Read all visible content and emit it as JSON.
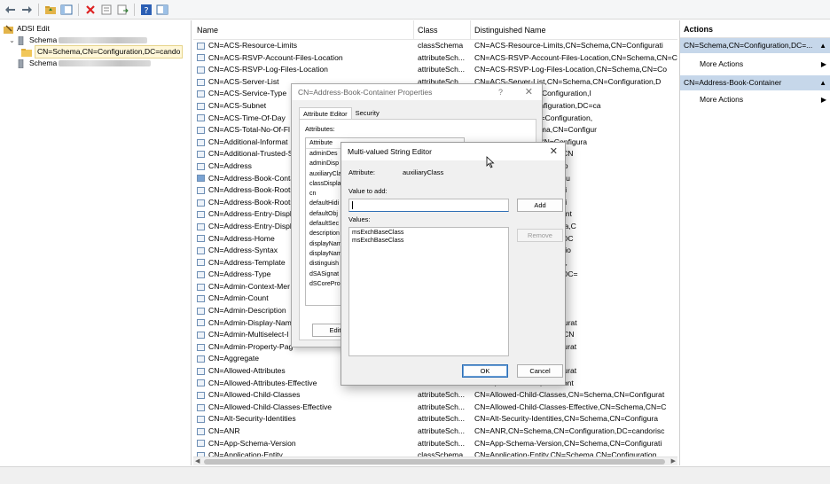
{
  "tree": {
    "root_label": "ADSI Edit",
    "schema_label": "Schema",
    "selected_label": "CN=Schema,CN=Configuration,DC=cando",
    "schema2_label": "Schema"
  },
  "list": {
    "headers": {
      "name": "Name",
      "class": "Class",
      "dn": "Distinguished Name"
    },
    "rows": [
      {
        "name": "CN=ACS-Resource-Limits",
        "class": "classSchema",
        "dn": "CN=ACS-Resource-Limits,CN=Schema,CN=Configurati"
      },
      {
        "name": "CN=ACS-RSVP-Account-Files-Location",
        "class": "attributeSch...",
        "dn": "CN=ACS-RSVP-Account-Files-Location,CN=Schema,CN=C"
      },
      {
        "name": "CN=ACS-RSVP-Log-Files-Location",
        "class": "attributeSch...",
        "dn": "CN=ACS-RSVP-Log-Files-Location,CN=Schema,CN=Co"
      },
      {
        "name": "CN=ACS-Server-List",
        "class": "attributeSch...",
        "dn": "CN=ACS-Server-List,CN=Schema,CN=Configuration,D"
      },
      {
        "name": "CN=ACS-Service-Type",
        "class": "",
        "dn": "e,CN=Schema,CN=Configuration,I"
      },
      {
        "name": "CN=ACS-Subnet",
        "class": "",
        "dn": "N=Schema,CN=Configuration,DC=ca"
      },
      {
        "name": "CN=ACS-Time-Of-Day",
        "class": "",
        "dn": "ay,CN=Schema,CN=Configuration,"
      },
      {
        "name": "CN=ACS-Total-No-Of-Fl",
        "class": "",
        "dn": "Of-Flows,CN=Schema,CN=Configur"
      },
      {
        "name": "CN=Additional-Informat",
        "class": "",
        "dn": "ation,CN=Schema,CN=Configura"
      },
      {
        "name": "CN=Additional-Trusted-S",
        "class": "",
        "dn": "vice-Names,CN=Schema,CN"
      },
      {
        "name": "CN=Address",
        "class": "",
        "dn": "N=Configuration,DC=cando"
      },
      {
        "name": "CN=Address-Book-Conta",
        "class": "",
        "dn": "er,CN=Schema,CN=Configu",
        "selected": true
      },
      {
        "name": "CN=Address-Book-Roots",
        "class": "",
        "dn": "N=Schema,CN=Configurati"
      },
      {
        "name": "CN=Address-Book-Roots",
        "class": "",
        "dn": "N=Schema,CN=Configurati"
      },
      {
        "name": "CN=Address-Entry-Displ",
        "class": "",
        "dn": "Table,CN=Schema,CN=Cont"
      },
      {
        "name": "CN=Address-Entry-Displ",
        "class": "",
        "dn": "Table-MSDOS,CN=Schema,C"
      },
      {
        "name": "CN=Address-Home",
        "class": "",
        "dn": "chema,CN=Configuration,DC"
      },
      {
        "name": "CN=Address-Syntax",
        "class": "",
        "dn": "N=Schema,CN=Configuratio"
      },
      {
        "name": "CN=Address-Template",
        "class": "",
        "dn": "Schema,CN=Configuration,"
      },
      {
        "name": "CN=Address-Type",
        "class": "",
        "dn": "chema,CN=Configuration,DC="
      },
      {
        "name": "CN=Admin-Context-Mer",
        "class": "",
        "dn": "N=Schema,CN=Configurat"
      },
      {
        "name": "CN=Admin-Count",
        "class": "",
        "dn": "N=Configuration,DC=cand"
      },
      {
        "name": "CN=Admin-Description",
        "class": "",
        "dn": "Schema,CN=Configuration"
      },
      {
        "name": "CN=Admin-Display-Nam",
        "class": "",
        "dn": "e,CN=Schema,CN=Configurat"
      },
      {
        "name": "CN=Admin-Multiselect-I",
        "class": "",
        "dn": "perty-Pages,CN=Schema,CN"
      },
      {
        "name": "CN=Admin-Property-Pag",
        "class": "",
        "dn": "s,CN=Schema,CN=Configurat"
      },
      {
        "name": "CN=Aggregate",
        "class": "",
        "dn": "N=Configuration,DC=can"
      },
      {
        "name": "CN=Allowed-Attributes",
        "class": "",
        "dn": "s,CN=Schema,CN=Configurat"
      },
      {
        "name": "CN=Allowed-Attributes-Effective",
        "class": "",
        "dn": "ective,CN=Schema,CN=Cont"
      },
      {
        "name": "CN=Allowed-Child-Classes",
        "class": "attributeSch...",
        "dn": "CN=Allowed-Child-Classes,CN=Schema,CN=Configurat"
      },
      {
        "name": "CN=Allowed-Child-Classes-Effective",
        "class": "attributeSch...",
        "dn": "CN=Allowed-Child-Classes-Effective,CN=Schema,CN=C"
      },
      {
        "name": "CN=Alt-Security-Identities",
        "class": "attributeSch...",
        "dn": "CN=Alt-Security-Identities,CN=Schema,CN=Configura"
      },
      {
        "name": "CN=ANR",
        "class": "attributeSch...",
        "dn": "CN=ANR,CN=Schema,CN=Configuration,DC=candorisc"
      },
      {
        "name": "CN=App-Schema-Version",
        "class": "attributeSch...",
        "dn": "CN=App-Schema-Version,CN=Schema,CN=Configurati"
      },
      {
        "name": "CN=Application-Entity",
        "class": "classSchema",
        "dn": "CN=Application-Entity,CN=Schema,CN=Configuration"
      }
    ]
  },
  "actions": {
    "title": "Actions",
    "section1": "CN=Schema,CN=Configuration,DC=...",
    "more1": "More Actions",
    "section2": "CN=Address-Book-Container",
    "more2": "More Actions"
  },
  "props": {
    "title": "CN=Address-Book-Container Properties",
    "help": "?",
    "tab_attr": "Attribute Editor",
    "tab_sec": "Security",
    "attributes_label": "Attributes:",
    "attr_header": "Attribute",
    "attrs": [
      "adminDes",
      "adminDisp",
      "auxiliaryCla",
      "classDispla",
      "cn",
      "defaultHidi",
      "defaultObj",
      "defaultSec",
      "description",
      "displayNam",
      "displayNam",
      "distinguish",
      "dSASignat",
      "dSCorePro"
    ],
    "edit_label": "Edit"
  },
  "mv": {
    "title": "Multi-valued String Editor",
    "attribute_label": "Attribute:",
    "attribute_value": "auxiliaryClass",
    "value_to_add_label": "Value to add:",
    "input_value": "",
    "add_label": "Add",
    "values_label": "Values:",
    "remove_label": "Remove",
    "values": [
      "msExchBaseClass",
      "msExchBaseClass"
    ],
    "ok_label": "OK",
    "cancel_label": "Cancel"
  }
}
